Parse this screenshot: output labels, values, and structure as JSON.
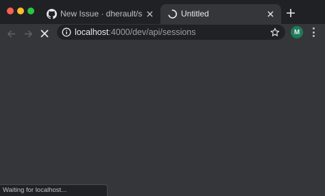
{
  "window": {
    "colors": {
      "frame": "#202124",
      "toolbar": "#35363a",
      "text": "#e8eaed",
      "muted": "#9aa0a6",
      "avatar": "#1e7b57"
    }
  },
  "tabs": [
    {
      "title": "New Issue · dherault/serverles",
      "favicon": "github-icon",
      "active": false
    },
    {
      "title": "Untitled",
      "favicon": "loading-spinner-icon",
      "active": true
    }
  ],
  "toolbar": {
    "url_host": "localhost",
    "url_path": ":4000/dev/api/sessions",
    "profile_initial": "M"
  },
  "status": {
    "text": "Waiting for localhost..."
  }
}
